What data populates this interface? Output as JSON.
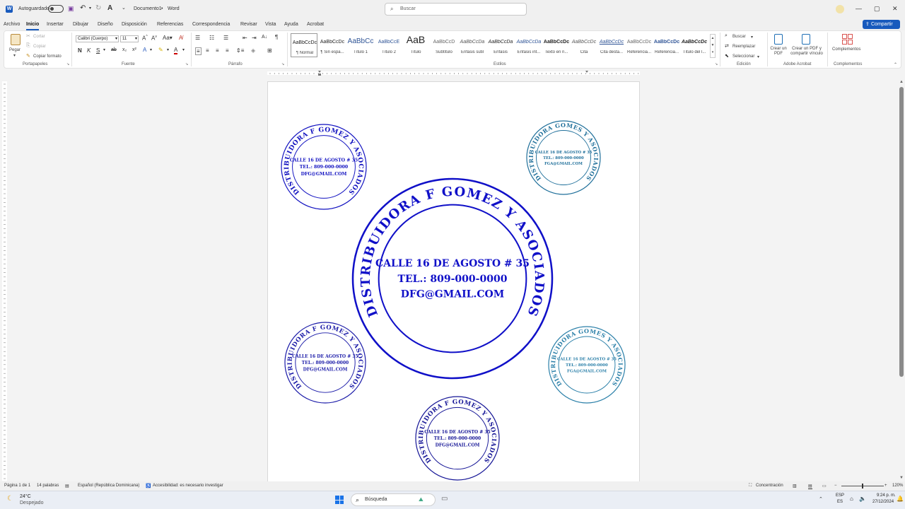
{
  "titlebar": {
    "autosave_label": "Autoguardado",
    "doc_title": "Documento1",
    "separator": "•",
    "app_name": "Word",
    "search_placeholder": "Buscar"
  },
  "menu": {
    "tabs": [
      "Archivo",
      "Inicio",
      "Insertar",
      "Dibujar",
      "Diseño",
      "Disposición",
      "Referencias",
      "Correspondencia",
      "Revisar",
      "Vista",
      "Ayuda",
      "Acrobat"
    ],
    "share_label": "Compartir"
  },
  "ribbon": {
    "clipboard": {
      "paste": "Pegar",
      "cut": "Cortar",
      "copy": "Copiar",
      "format_painter": "Copiar formato",
      "group": "Portapapeles"
    },
    "font": {
      "name": "Calibri (Cuerpo)",
      "size": "11",
      "group": "Fuente"
    },
    "paragraph": {
      "group": "Párrafo"
    },
    "styles": {
      "group": "Estilos",
      "items": [
        {
          "sample": "AaBbCcDc",
          "name": "¶ Normal"
        },
        {
          "sample": "AaBbCcDc",
          "name": "¶ Sin espa..."
        },
        {
          "sample": "AaBbCc",
          "name": "Título 1"
        },
        {
          "sample": "AaBbCcE",
          "name": "Título 2"
        },
        {
          "sample": "AaB",
          "name": "Título"
        },
        {
          "sample": "AaBbCcD",
          "name": "Subtítulo"
        },
        {
          "sample": "AaBbCcDa",
          "name": "Énfasis sutil"
        },
        {
          "sample": "AaBbCcDa",
          "name": "Énfasis"
        },
        {
          "sample": "AaBbCcDa",
          "name": "Énfasis int..."
        },
        {
          "sample": "AaBbCcDc",
          "name": "Texto en n..."
        },
        {
          "sample": "AaBbCcDc",
          "name": "Cita"
        },
        {
          "sample": "AaBbCcDc",
          "name": "Cita desta..."
        },
        {
          "sample": "AaBbCcDc",
          "name": "Referencia..."
        },
        {
          "sample": "AaBbCcDc",
          "name": "Referencia..."
        },
        {
          "sample": "AaBbCcDc",
          "name": "Título del l..."
        }
      ]
    },
    "editing": {
      "find": "Buscar",
      "replace": "Reemplazar",
      "select": "Seleccionar",
      "group": "Edición"
    },
    "acrobat": {
      "create_pdf": "Crear un PDF",
      "create_share": "Crear un PDF y compartir vínculo",
      "group": "Adobe Acrobat"
    },
    "addins": {
      "label": "Complementos",
      "group": "Complementos"
    }
  },
  "document": {
    "stamps": [
      {
        "ring": "DISTRIBUIDORA F GOMEZ Y ASOCIADOS",
        "address": "CALLE 16 DE AGOSTO # 35",
        "phone": "TEL.: 809-000-0000",
        "email": "DFG@GMAIL.COM",
        "color": "#1010c0"
      },
      {
        "ring": "DISTRIBUIDORA GOMES Y ASOCIADOS",
        "address": "CALLE 16 DE AGOSTO # 35",
        "phone": "TEL.: 809-000-0000",
        "email": "FGA@GMAIL.COM",
        "color": "#1f6f9a"
      },
      {
        "ring": "DISTRIBUIDORA F GOMEZ Y ASOCIADOS",
        "address": "CALLE 16 DE AGOSTO # 35",
        "phone": "TEL.: 809-000-0000",
        "email": "DFG@GMAIL.COM",
        "color": "#1010c8"
      },
      {
        "ring": "DISTRIBUIDORA F GOMEZ Y ASOCIADOS",
        "address": "CALLE 16 DE AGOSTO # 35",
        "phone": "TEL.: 809-000-0000",
        "email": "DFG@GMAIL.COM",
        "color": "#1a1aa8"
      },
      {
        "ring": "DISTRIBUIDORA GOMES Y ASOCIADOS",
        "address": "CALLE 16 DE AGOSTO # 35",
        "phone": "TEL.: 809-000-0000",
        "email": "FGA@GMAIL.COM",
        "color": "#2a7fa8"
      },
      {
        "ring": "DISTRIBUIDORA F GOMEZ Y ASOCIADOS",
        "address": "CALLE 16 DE AGOSTO # 35",
        "phone": "TEL.: 809-000-0000",
        "email": "DFG@GMAIL.COM",
        "color": "#141496"
      }
    ]
  },
  "statusbar": {
    "page": "Página 1 de 1",
    "words": "14 palabras",
    "language": "Español (República Dominicana)",
    "accessibility": "Accesibilidad: es necesario investigar",
    "focus": "Concentración",
    "zoom": "120%"
  },
  "taskbar": {
    "temperature": "24°C",
    "weather": "Despejado",
    "search": "Búsqueda",
    "lang_top": "ESP",
    "lang_bottom": "ES",
    "time": "9:24 p. m.",
    "date": "27/12/2024"
  }
}
